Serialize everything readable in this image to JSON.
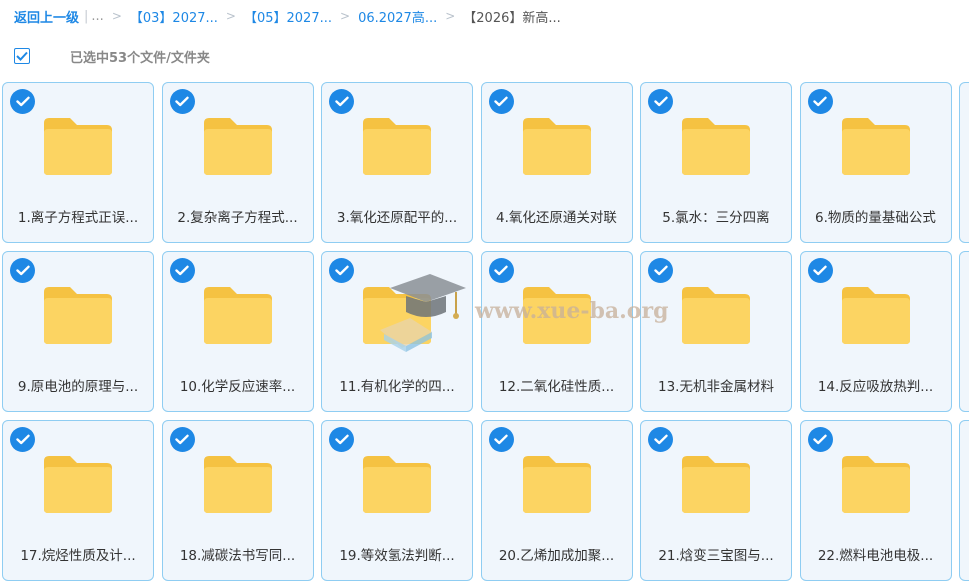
{
  "breadcrumb": {
    "back": "返回上一级",
    "bar": "|",
    "ellipsis": "...",
    "sep": ">",
    "items": [
      "【03】2027...",
      "【05】2027...",
      "06.2027高..."
    ],
    "current": "【2026】新高..."
  },
  "selection": {
    "text": "已选中53个文件/文件夹"
  },
  "watermark": {
    "text": "www.xue-ba.org"
  },
  "files": [
    "1.离子方程式正误...",
    "2.复杂离子方程式...",
    "3.氧化还原配平的...",
    "4.氧化还原通关对联",
    "5.氯水：三分四离",
    "6.物质的量基础公式",
    "9.原电池的原理与...",
    "10.化学反应速率...",
    "11.有机化学的四...",
    "12.二氧化硅性质...",
    "13.无机非金属材料",
    "14.反应吸放热判...",
    "17.烷烃性质及计...",
    "18.减碳法书写同...",
    "19.等效氢法判断...",
    "20.乙烯加成加聚...",
    "21.焓变三宝图与...",
    "22.燃料电池电极..."
  ],
  "colors": {
    "accent": "#1e88e5",
    "folder_back": "#f5c242",
    "folder_front": "#fcd462",
    "card_border": "#8fcdf2",
    "card_bg": "#f0f6fc"
  }
}
